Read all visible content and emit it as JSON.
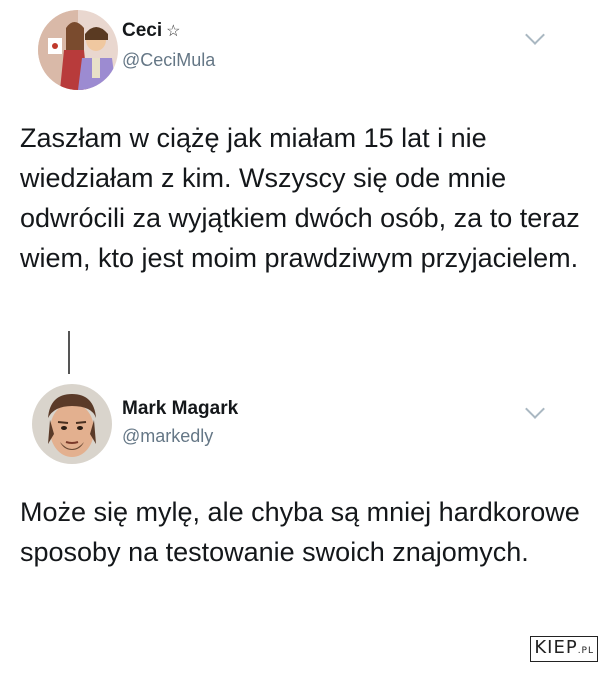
{
  "tweets": [
    {
      "display_name": "Ceci",
      "badge_icon": "star-icon",
      "handle": "@CeciMula",
      "body": "Zaszłam w ciążę jak miałam 15 lat i nie wiedziałam z kim. Wszyscy się ode mnie odwrócili za wyjątkiem dwóch osób, za to teraz wiem, kto jest moim prawdziwym przyjacielem."
    },
    {
      "display_name": "Mark Magark",
      "handle": "@markedly",
      "body": "Może się mylę, ale chyba są mniej hardkorowe sposoby na testowanie swoich znajomych."
    }
  ],
  "watermark": {
    "main": "KIEP",
    "suffix": ".PL"
  }
}
